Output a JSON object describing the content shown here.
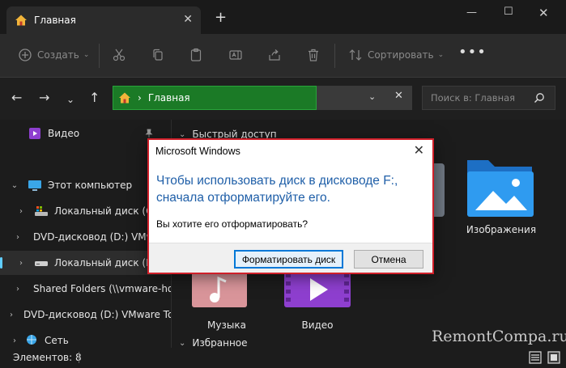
{
  "tab": {
    "title": "Главная"
  },
  "toolbar": {
    "create_label": "Создать",
    "sort_label": "Сортировать",
    "more_label": "•••"
  },
  "address": {
    "chevron": "›",
    "location": "Главная"
  },
  "search": {
    "placeholder": "Поиск в: Главная"
  },
  "sidebar": {
    "items": [
      {
        "label": "Видео"
      },
      {
        "label": "Этот компьютер"
      },
      {
        "label": "Локальный диск (C:)"
      },
      {
        "label": "DVD-дисковод (D:) VMware Tools"
      },
      {
        "label": "Локальный диск (F:)"
      },
      {
        "label": "Shared Folders (\\\\vmware-host)"
      },
      {
        "label": "DVD-дисковод (D:) VMware Tools"
      },
      {
        "label": "Сеть"
      }
    ]
  },
  "main": {
    "quick_access": "Быстрый доступ",
    "favorites": "Избранное",
    "tiles": [
      {
        "label": "Изображения"
      },
      {
        "label": "Музыка"
      },
      {
        "label": "Видео"
      }
    ]
  },
  "status": {
    "count": "Элементов: 8"
  },
  "watermark": "RemontCompa.ru",
  "dialog": {
    "title": "Microsoft Windows",
    "close": "✕",
    "message": "Чтобы использовать диск в дисководе F:, сначала отформатируйте его.",
    "question": "Вы хотите его отформатировать?",
    "format_button": "Форматировать диск",
    "cancel_button": "Отмена"
  },
  "colors": {
    "accent": "#60cdff",
    "address_green": "#1b7a26",
    "dialog_border": "#d0202a",
    "dialog_text": "#1f5fa8"
  }
}
